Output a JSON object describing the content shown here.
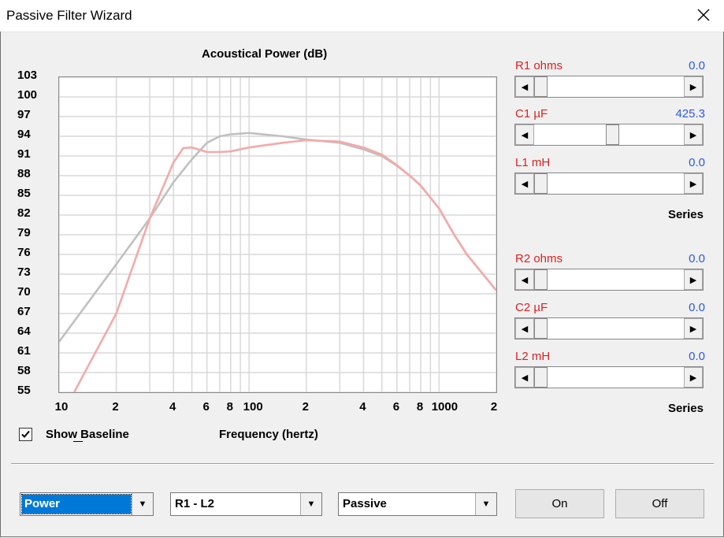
{
  "window": {
    "title": "Passive Filter Wizard"
  },
  "chart_data": {
    "type": "line",
    "title": "Acoustical Power (dB)",
    "xlabel": "Frequency (hertz)",
    "ylabel": "",
    "x_scale": "log",
    "xlim": [
      10,
      2000
    ],
    "ylim": [
      55,
      103
    ],
    "y_ticks": [
      "103",
      "100",
      "97",
      "94",
      "91",
      "88",
      "85",
      "82",
      "79",
      "76",
      "73",
      "70",
      "67",
      "64",
      "61",
      "58",
      "55"
    ],
    "x_ticks": [
      "10",
      "2",
      "4",
      "6",
      "8",
      "100",
      "2",
      "4",
      "6",
      "8",
      "1000",
      "2"
    ],
    "grid": true,
    "series": [
      {
        "color": "#c0c0c0",
        "points": [
          [
            10,
            62.7
          ],
          [
            20,
            74.5
          ],
          [
            30,
            81.5
          ],
          [
            40,
            87
          ],
          [
            50,
            90.5
          ],
          [
            60,
            93
          ],
          [
            70,
            94
          ],
          [
            80,
            94.3
          ],
          [
            100,
            94.5
          ],
          [
            150,
            94
          ],
          [
            200,
            93.5
          ],
          [
            300,
            93
          ],
          [
            400,
            92
          ],
          [
            500,
            91
          ],
          [
            600,
            89.5
          ],
          [
            700,
            88
          ],
          [
            800,
            86.5
          ],
          [
            1000,
            83
          ],
          [
            1200,
            79
          ],
          [
            1400,
            76
          ],
          [
            2000,
            70.5
          ]
        ]
      },
      {
        "color": "#f4a9a9",
        "points": [
          [
            12,
            55
          ],
          [
            20,
            67
          ],
          [
            30,
            81.5
          ],
          [
            40,
            90
          ],
          [
            45,
            92.2
          ],
          [
            50,
            92.3
          ],
          [
            60,
            91.6
          ],
          [
            70,
            91.6
          ],
          [
            80,
            91.7
          ],
          [
            100,
            92.3
          ],
          [
            150,
            93
          ],
          [
            200,
            93.4
          ],
          [
            300,
            93.2
          ],
          [
            400,
            92.3
          ],
          [
            500,
            91.2
          ],
          [
            600,
            89.6
          ],
          [
            700,
            88
          ],
          [
            800,
            86.5
          ],
          [
            1000,
            83
          ],
          [
            1200,
            79
          ],
          [
            1400,
            76
          ],
          [
            2000,
            70.5
          ]
        ]
      }
    ]
  },
  "checkbox": {
    "label": "Show Baseline",
    "checked": true
  },
  "params_top": [
    {
      "label": "R1  ohms",
      "value": "0.0",
      "fraction": 0.0
    },
    {
      "label": "C1  µF",
      "value": "425.3",
      "fraction": 0.52
    },
    {
      "label": "L1  mH",
      "value": "0.0",
      "fraction": 0.0
    }
  ],
  "group_top": "Series",
  "params_bottom": [
    {
      "label": "R2  ohms",
      "value": "0.0",
      "fraction": 0.0
    },
    {
      "label": "C2  µF",
      "value": "0.0",
      "fraction": 0.0
    },
    {
      "label": "L2  mH",
      "value": "0.0",
      "fraction": 0.0
    }
  ],
  "group_bottom": "Series",
  "dropdowns": {
    "mode": "Power",
    "range": "R1 - L2",
    "type": "Passive"
  },
  "buttons": {
    "on": "On",
    "off": "Off"
  }
}
